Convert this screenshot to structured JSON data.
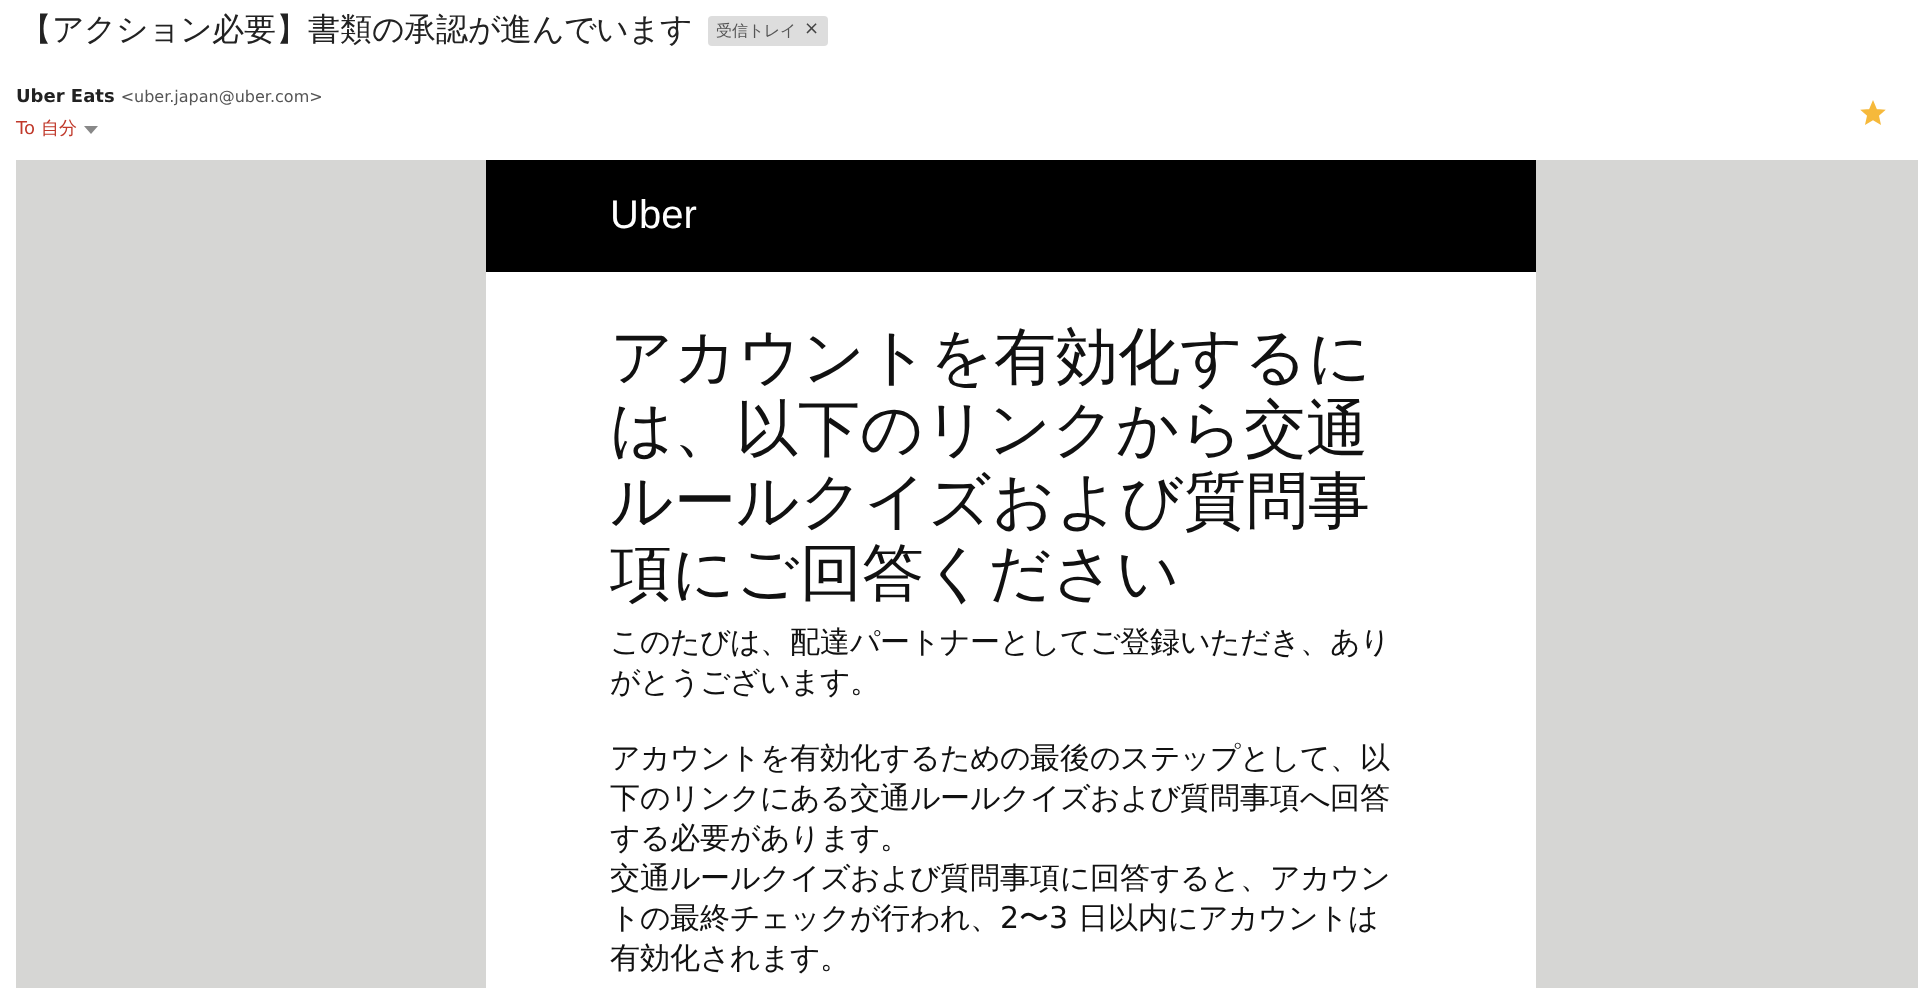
{
  "email": {
    "subject": "【アクション必要】書類の承認が進んでいます",
    "label": "受信トレイ",
    "label_close": "×",
    "sender_name": "Uber Eats",
    "sender_address": "<uber.japan@uber.com>",
    "recipient": "To 自分",
    "starred": true
  },
  "message": {
    "brand": "Uber",
    "heading": "アカウントを有効化するには、以下のリンクから交通ルールクイズおよび質問事項にご回答ください",
    "paragraphs": [
      [
        "このたびは、配達パートナーとしてご登録いただき、ありがとうございます。"
      ],
      [
        "アカウントを有効化するための最後のステップとして、以下のリンクにある交通ルールクイズおよび質問事項へ回答する必要があります。",
        "交通ルールクイズおよび質問事項に回答すると、アカウントの最終チェックが行われ、2〜3 日以内にアカウントは有効化されます。"
      ]
    ]
  }
}
